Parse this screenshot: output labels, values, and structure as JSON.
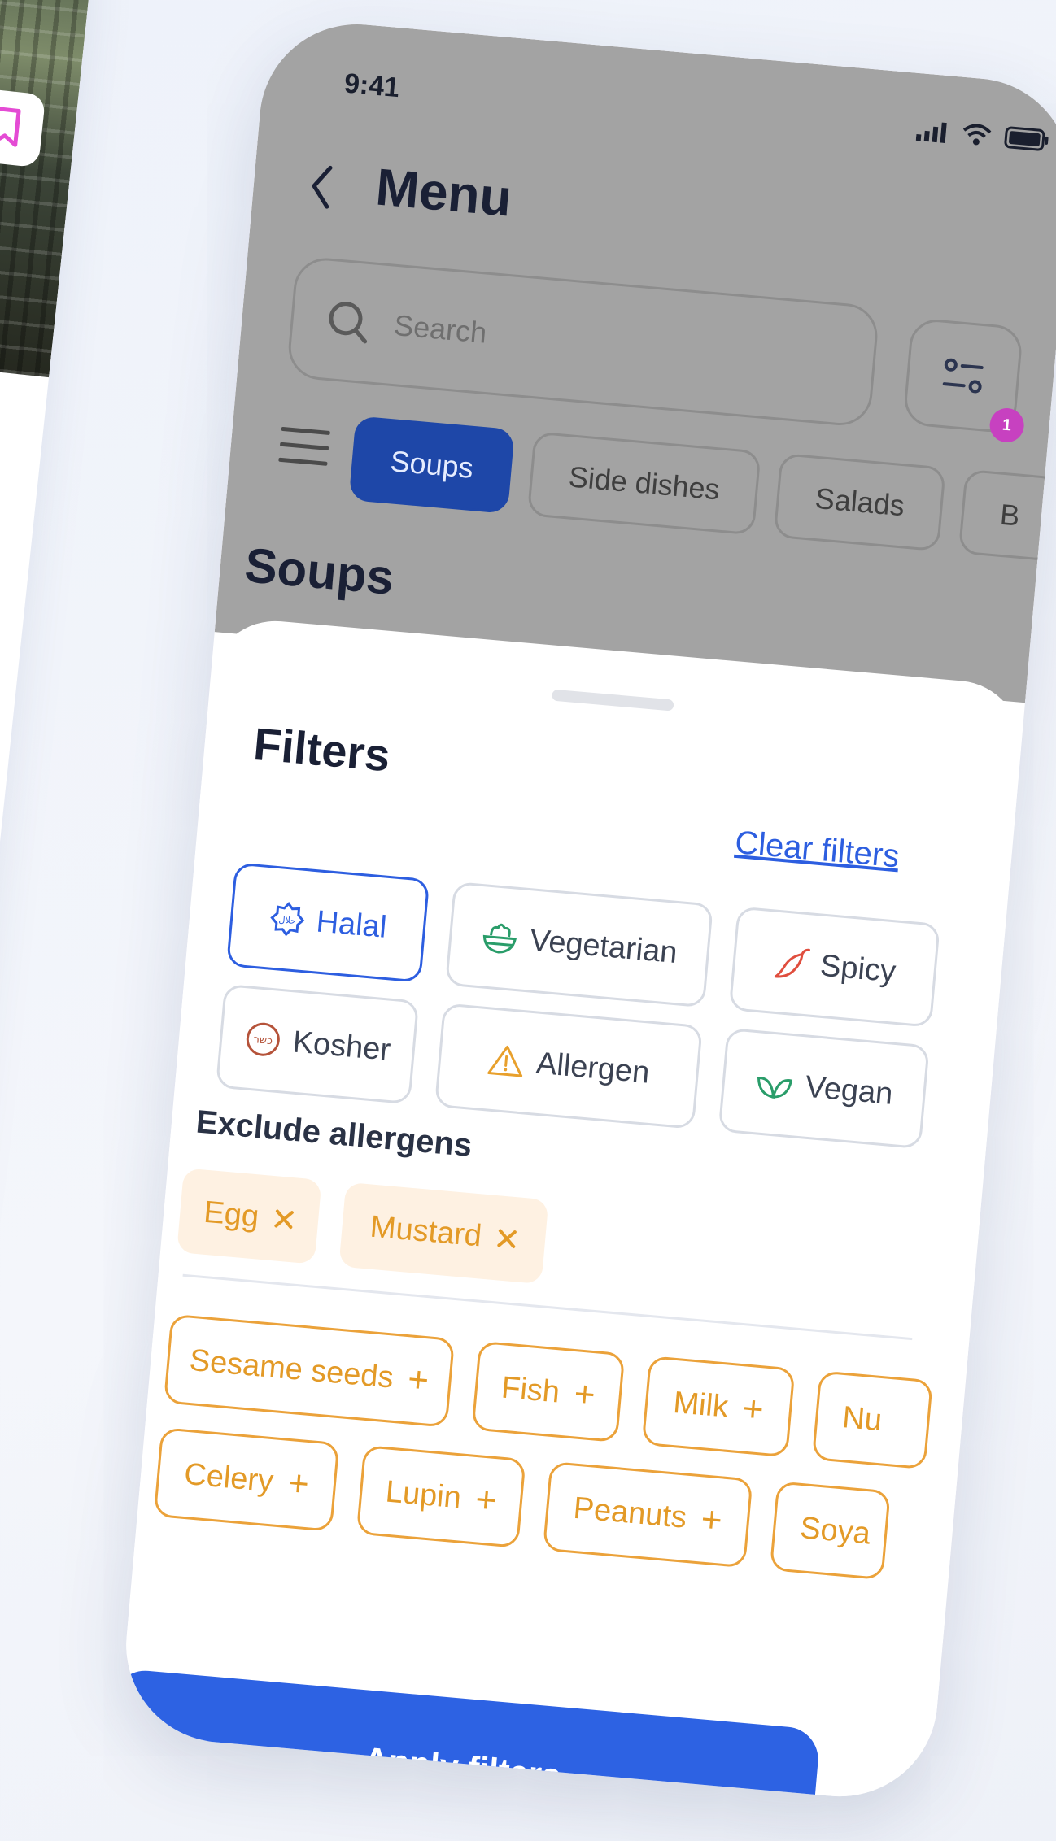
{
  "status": {
    "time": "9:41"
  },
  "header": {
    "title": "Menu"
  },
  "search": {
    "placeholder": "Search"
  },
  "filter_button": {
    "badge": "1"
  },
  "categories": [
    {
      "label": "Soups",
      "active": true
    },
    {
      "label": "Side dishes",
      "active": false
    },
    {
      "label": "Salads",
      "active": false
    },
    {
      "label": "B",
      "active": false
    }
  ],
  "section": {
    "title": "Soups"
  },
  "sheet": {
    "title": "Filters",
    "clear_label": "Clear filters",
    "diet_chips": [
      {
        "label": "Halal",
        "icon": "halal-icon",
        "selected": true
      },
      {
        "label": "Vegetarian",
        "icon": "salad-bowl-icon",
        "selected": false
      },
      {
        "label": "Spicy",
        "icon": "chili-pepper-icon",
        "selected": false
      },
      {
        "label": "Kosher",
        "icon": "kosher-icon",
        "selected": false
      },
      {
        "label": "Allergen",
        "icon": "warning-triangle-icon",
        "selected": false
      },
      {
        "label": "Vegan",
        "icon": "leaf-icon",
        "selected": false
      }
    ],
    "exclude_title": "Exclude allergens",
    "excluded": [
      {
        "label": "Egg"
      },
      {
        "label": "Mustard"
      }
    ],
    "available": [
      {
        "label": "Sesame seeds"
      },
      {
        "label": "Fish"
      },
      {
        "label": "Milk"
      },
      {
        "label": "Nu"
      },
      {
        "label": "Celery"
      },
      {
        "label": "Lupin"
      },
      {
        "label": "Peanuts"
      },
      {
        "label": "Soya"
      }
    ],
    "apply_label": "Apply filters"
  },
  "colors": {
    "primary": "#2d62e3",
    "selected_chip": "#2d5ee0",
    "allergen_orange": "#e39a27",
    "badge": "#c741c0",
    "overlay_gray": "#a3a3a3"
  }
}
